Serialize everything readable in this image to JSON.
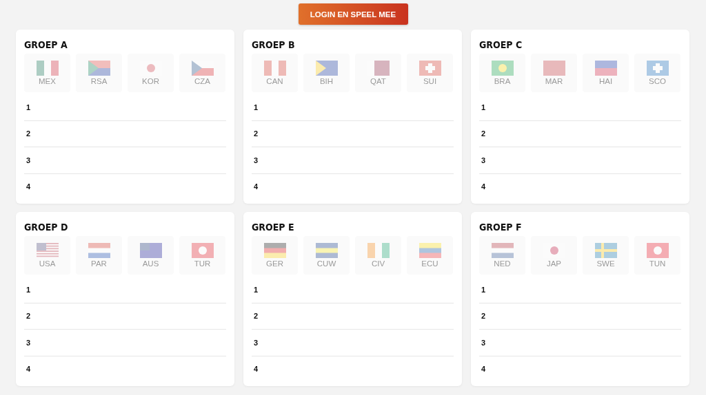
{
  "login_button": "LOGIN EN SPEEL MEE",
  "groups": [
    {
      "title": "GROEP A",
      "teams": [
        {
          "code": "MEX",
          "disabled": true
        },
        {
          "code": "RSA",
          "disabled": true
        },
        {
          "code": "KOR",
          "disabled": true
        },
        {
          "code": "CZA",
          "disabled": true
        }
      ],
      "ranks": [
        "1",
        "2",
        "3",
        "4"
      ]
    },
    {
      "title": "GROEP B",
      "teams": [
        {
          "code": "CAN",
          "disabled": true
        },
        {
          "code": "BIH",
          "disabled": true
        },
        {
          "code": "QAT",
          "disabled": true
        },
        {
          "code": "SUI",
          "disabled": true
        }
      ],
      "ranks": [
        "1",
        "2",
        "3",
        "4"
      ]
    },
    {
      "title": "GROEP C",
      "teams": [
        {
          "code": "BRA",
          "disabled": true
        },
        {
          "code": "MAR",
          "disabled": true
        },
        {
          "code": "HAI",
          "disabled": true
        },
        {
          "code": "SCO",
          "disabled": true
        }
      ],
      "ranks": [
        "1",
        "2",
        "3",
        "4"
      ]
    },
    {
      "title": "GROEP D",
      "teams": [
        {
          "code": "USA",
          "disabled": true
        },
        {
          "code": "PAR",
          "disabled": true
        },
        {
          "code": "AUS",
          "disabled": true
        },
        {
          "code": "TUR",
          "disabled": true
        }
      ],
      "ranks": [
        "1",
        "2",
        "3",
        "4"
      ]
    },
    {
      "title": "GROEP E",
      "teams": [
        {
          "code": "GER",
          "disabled": true
        },
        {
          "code": "CUW",
          "disabled": true
        },
        {
          "code": "CIV",
          "disabled": true
        },
        {
          "code": "ECU",
          "disabled": true
        }
      ],
      "ranks": [
        "1",
        "2",
        "3",
        "4"
      ]
    },
    {
      "title": "GROEP F",
      "teams": [
        {
          "code": "NED",
          "disabled": true
        },
        {
          "code": "JAP",
          "disabled": true
        },
        {
          "code": "SWE",
          "disabled": true
        },
        {
          "code": "TUN",
          "disabled": true
        }
      ],
      "ranks": [
        "1",
        "2",
        "3",
        "4"
      ]
    }
  ]
}
